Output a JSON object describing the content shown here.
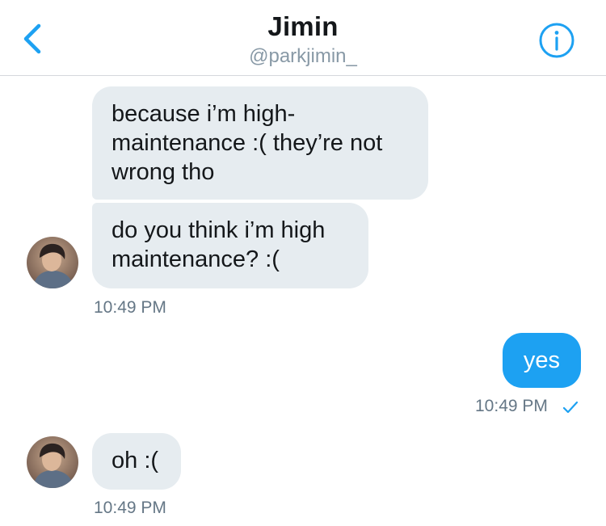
{
  "header": {
    "title": "Jimin",
    "handle": "@parkjimin_"
  },
  "icons": {
    "back": "chevron-left-icon",
    "info": "info-circle-icon",
    "read": "checkmark-icon"
  },
  "colors": {
    "accent": "#1da1f2",
    "incoming_bubble": "#e6ecf0",
    "timestamp": "#657786"
  },
  "messages": [
    {
      "direction": "incoming",
      "text": "because i’m high-maintenance :( they’re not wrong tho"
    },
    {
      "direction": "incoming",
      "text": "do you think i’m high maintenance? :("
    },
    {
      "direction": "outgoing",
      "text": "yes"
    },
    {
      "direction": "incoming",
      "text": "oh :("
    }
  ],
  "timestamps": [
    "10:49 PM",
    "10:49 PM",
    "10:49 PM"
  ]
}
